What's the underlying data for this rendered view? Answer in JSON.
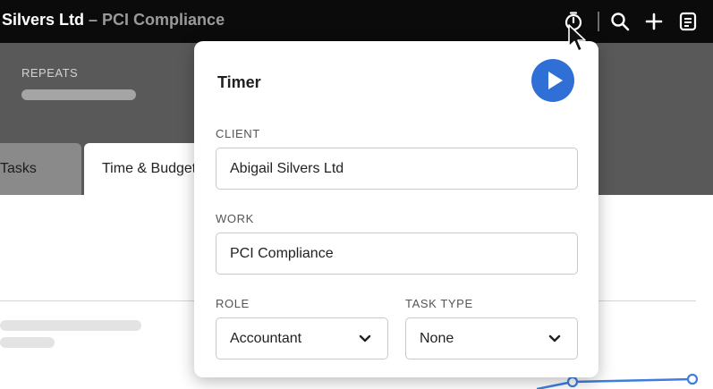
{
  "topbar": {
    "client_name": "Silvers Ltd",
    "separator": " – ",
    "work_name": "PCI Compliance",
    "icons": [
      "timer-icon",
      "search-icon",
      "plus-icon",
      "notes-icon"
    ]
  },
  "header": {
    "repeats_label": "REPEATS"
  },
  "tabs": [
    {
      "label": "Tasks"
    },
    {
      "label": "Time & Budget"
    }
  ],
  "timer": {
    "heading": "Timer",
    "client_label": "CLIENT",
    "client_value": "Abigail Silvers Ltd",
    "work_label": "WORK",
    "work_value": "PCI Compliance",
    "role_label": "ROLE",
    "role_value": "Accountant",
    "task_type_label": "TASK TYPE",
    "task_type_value": "None"
  },
  "colors": {
    "topbar": "#0b0b0b",
    "band": "#595959",
    "accent": "#2f6fd6",
    "chart_line": "#3d7ee0"
  }
}
